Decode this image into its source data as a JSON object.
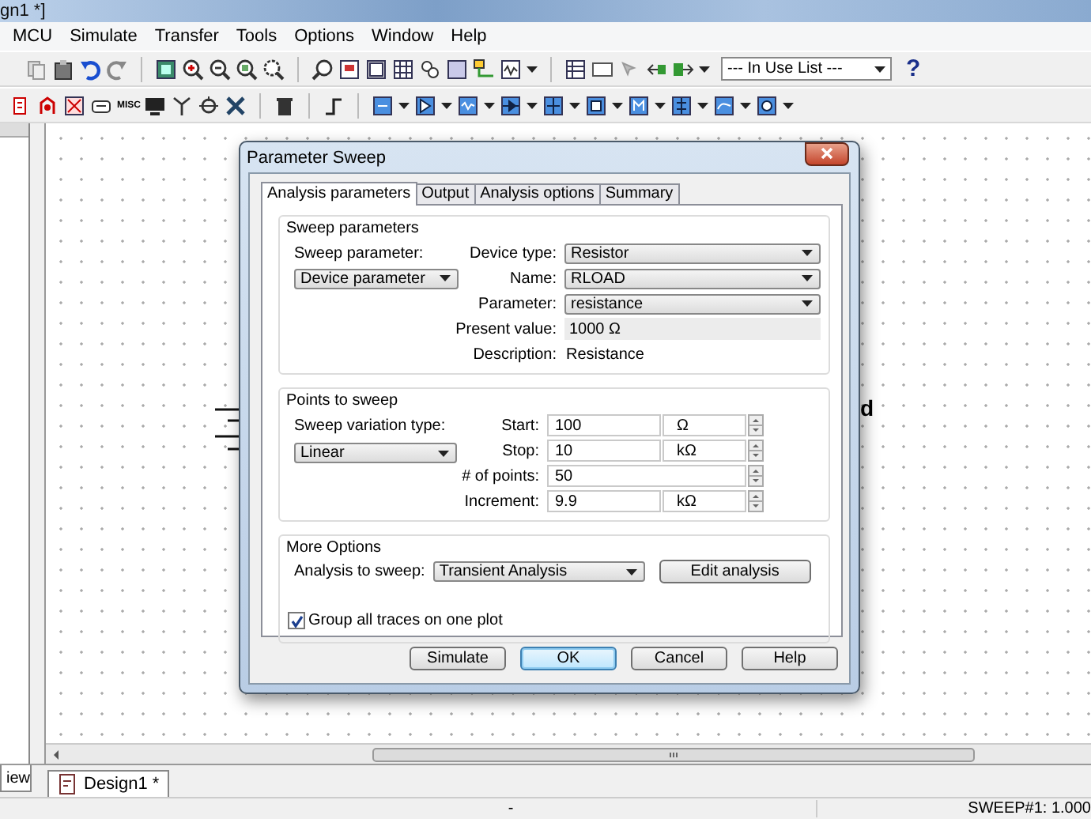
{
  "window": {
    "title": "gn1 *]"
  },
  "menu": [
    "MCU",
    "Simulate",
    "Transfer",
    "Tools",
    "Options",
    "Window",
    "Help"
  ],
  "toolbar": {
    "in_use_list": "--- In Use List ---",
    "help": "?",
    "misc_label": "MISC"
  },
  "canvas": {
    "label_fragment": "d"
  },
  "dialog": {
    "title": "Parameter Sweep",
    "tabs": [
      {
        "label": "Analysis parameters",
        "selected": true
      },
      {
        "label": "Output",
        "selected": false
      },
      {
        "label": "Analysis options",
        "selected": false
      },
      {
        "label": "Summary",
        "selected": false
      }
    ],
    "sweep_parameters": {
      "title": "Sweep parameters",
      "sweep_parameter_label": "Sweep parameter:",
      "sweep_parameter": "Device parameter",
      "fields": [
        {
          "label": "Device type:",
          "value": "Resistor",
          "kind": "dropdown"
        },
        {
          "label": "Name:",
          "value": "RLOAD",
          "kind": "dropdown"
        },
        {
          "label": "Parameter:",
          "value": "resistance",
          "kind": "dropdown"
        },
        {
          "label": "Present value:",
          "value": "1000 Ω",
          "kind": "readonly"
        },
        {
          "label": "Description:",
          "value": "Resistance",
          "kind": "plain"
        }
      ]
    },
    "points_to_sweep": {
      "title": "Points to sweep",
      "variation_label": "Sweep variation type:",
      "variation": "Linear",
      "fields": [
        {
          "label": "Start:",
          "value": "100",
          "unit": "Ω"
        },
        {
          "label": "Stop:",
          "value": "10",
          "unit": "kΩ"
        },
        {
          "label": "# of points:",
          "value": "50"
        },
        {
          "label": "Increment:",
          "value": "9.9",
          "unit": "kΩ"
        }
      ]
    },
    "more_options": {
      "title": "More Options",
      "analysis_label": "Analysis to sweep:",
      "analysis": "Transient Analysis",
      "edit_button": "Edit analysis",
      "group_traces": {
        "label": "Group all traces on one plot",
        "checked": true
      }
    },
    "buttons": [
      {
        "label": "Simulate",
        "default": false
      },
      {
        "label": "OK",
        "default": true
      },
      {
        "label": "Cancel",
        "default": false
      },
      {
        "label": "Help",
        "default": false
      }
    ]
  },
  "left_panel": {
    "tab": "iew"
  },
  "document_tabs": [
    {
      "label": "Design1 *",
      "selected": true
    }
  ],
  "status_bar": {
    "center": "-",
    "right": "SWEEP#1: 1.000"
  }
}
